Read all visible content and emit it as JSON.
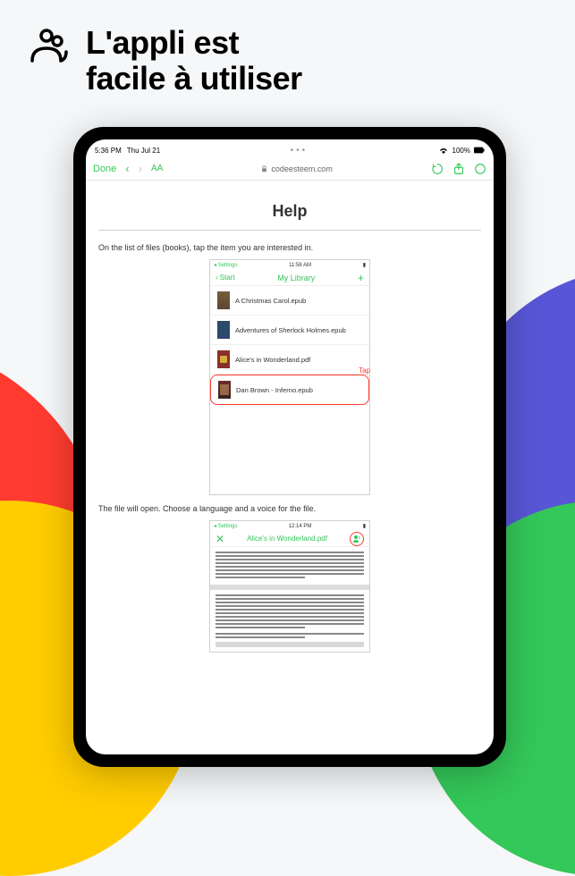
{
  "headline": "L'appli est\nfacile à utiliser",
  "status": {
    "time": "5:36 PM",
    "date": "Thu Jul 21",
    "battery": "100%"
  },
  "nav": {
    "done": "Done",
    "aa": "AA",
    "url": "codeesteem.com"
  },
  "help": {
    "title": "Help",
    "p1": "On the list of files (books), tap the item you are interested in.",
    "p2": "The file will open. Choose a language and a voice for the file."
  },
  "phone1": {
    "settings": "Settings",
    "time": "11:58 AM",
    "start": "Start",
    "title": "My Library",
    "tap": "Tap",
    "files": [
      "A Christmas Carol.epub",
      "Adventures of Sherlock Holmes.epub",
      "Alice's in Wonderland.pdf",
      "Dan Brown - Inferno.epub"
    ]
  },
  "phone2": {
    "settings": "Settings",
    "time": "12:14 PM",
    "title": "Alice's in Wonderland.pdf"
  }
}
